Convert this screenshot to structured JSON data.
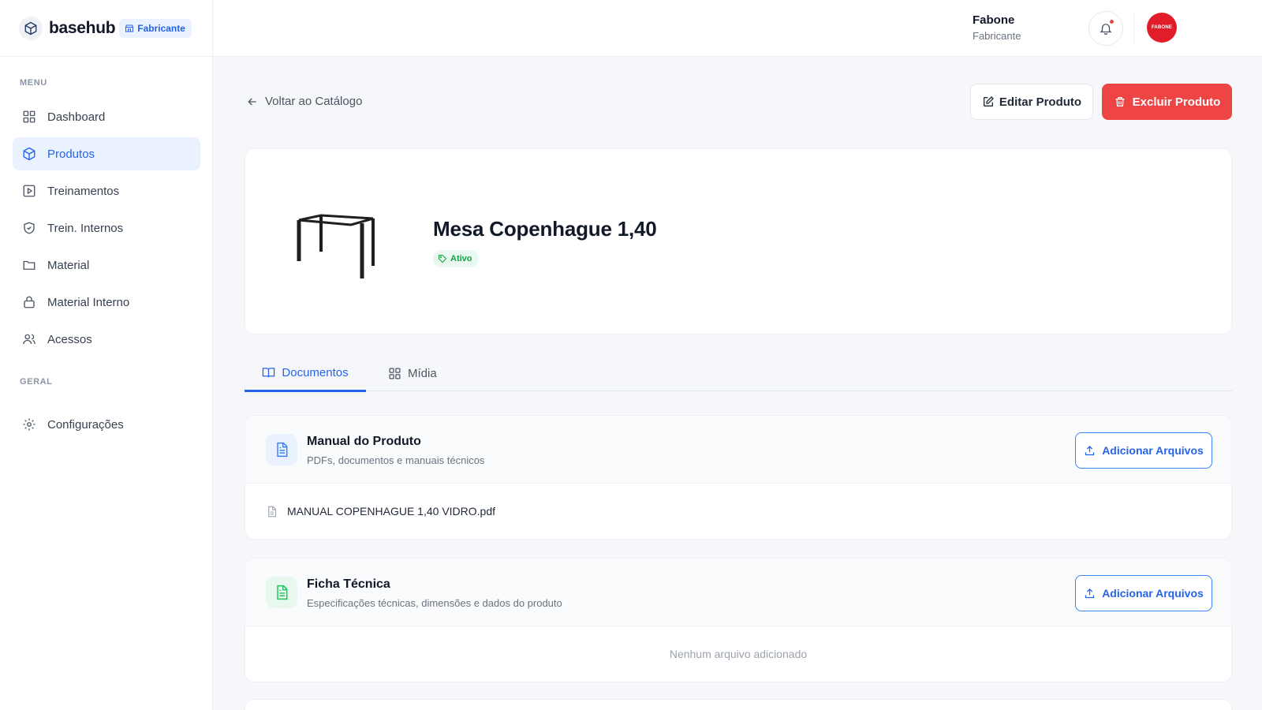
{
  "brand": {
    "name": "basehub",
    "badge": "Fabricante"
  },
  "sidebar": {
    "menu_label": "MENU",
    "items": [
      {
        "label": "Dashboard",
        "icon": "dashboard-icon"
      },
      {
        "label": "Produtos",
        "icon": "box-icon",
        "active": true
      },
      {
        "label": "Treinamentos",
        "icon": "video-icon"
      },
      {
        "label": "Trein. Internos",
        "icon": "shield-icon"
      },
      {
        "label": "Material",
        "icon": "folder-icon"
      },
      {
        "label": "Material Interno",
        "icon": "lock-icon"
      },
      {
        "label": "Acessos",
        "icon": "users-icon"
      }
    ],
    "general_label": "GERAL",
    "general_items": [
      {
        "label": "Configurações",
        "icon": "gear-icon"
      }
    ]
  },
  "header": {
    "user_name": "Fabone",
    "user_role": "Fabricante",
    "avatar_text": "FABONE"
  },
  "page": {
    "back_label": "Voltar ao Catálogo",
    "edit_label": "Editar Produto",
    "delete_label": "Excluir Produto"
  },
  "product": {
    "title": "Mesa Copenhague 1,40",
    "status": "Ativo"
  },
  "tabs": [
    {
      "label": "Documentos",
      "active": true
    },
    {
      "label": "Mídia",
      "active": false
    }
  ],
  "sections": [
    {
      "title": "Manual do Produto",
      "subtitle": "PDFs, documentos e manuais técnicos",
      "button": "Adicionar Arquivos",
      "files": [
        "MANUAL COPENHAGUE 1,40 VIDRO.pdf"
      ]
    },
    {
      "title": "Ficha Técnica",
      "subtitle": "Especificações técnicas, dimensões e dados do produto",
      "button": "Adicionar Arquivos",
      "empty_text": "Nenhum arquivo adicionado"
    }
  ],
  "colors": {
    "accent": "#2563eb",
    "danger": "#ef4444",
    "success": "#16a34a"
  }
}
